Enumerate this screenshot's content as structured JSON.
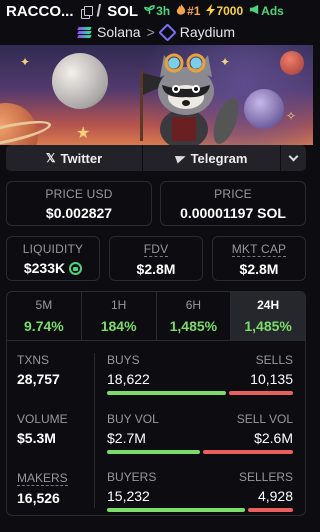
{
  "header": {
    "token_name": "RACCO...",
    "slash": "/",
    "quote": "SOL",
    "age": "3h",
    "rank": "#1",
    "boosts": "7000",
    "ads": "Ads"
  },
  "chain": {
    "chain_name": "Solana",
    "separator": ">",
    "dex_name": "Raydium"
  },
  "social": {
    "twitter_label": "Twitter",
    "telegram_label": "Telegram"
  },
  "price_usd": {
    "label": "PRICE USD",
    "value": "$0.002827"
  },
  "price_native": {
    "label": "PRICE",
    "value": "0.00001197 SOL"
  },
  "liquidity": {
    "label": "LIQUIDITY",
    "value": "$233K"
  },
  "fdv": {
    "label": "FDV",
    "value": "$2.8M"
  },
  "mcap": {
    "label": "MKT CAP",
    "value": "$2.8M"
  },
  "tabs": [
    {
      "label": "5M",
      "change": "9.74%"
    },
    {
      "label": "1H",
      "change": "184%"
    },
    {
      "label": "6H",
      "change": "1,485%"
    },
    {
      "label": "24H",
      "change": "1,485%"
    }
  ],
  "active_tab": "24H",
  "txns": {
    "label": "TXNS",
    "value": "28,757",
    "buys_label": "BUYS",
    "buys": "18,622",
    "sells_label": "SELLS",
    "sells": "10,135",
    "buy_fraction": 0.648
  },
  "volume": {
    "label": "VOLUME",
    "value": "$5.3M",
    "buy_label": "BUY VOL",
    "buy": "$2.7M",
    "sell_label": "SELL VOL",
    "sell": "$2.6M",
    "buy_fraction": 0.51
  },
  "makers": {
    "label": "MAKERS",
    "value": "16,526",
    "buyers_label": "BUYERS",
    "buyers": "15,232",
    "sellers_label": "SELLERS",
    "sellers": "4,928",
    "buy_fraction": 0.756
  },
  "colors": {
    "positive": "#7bdc6a",
    "negative": "#ea5e5e",
    "rank": "#f7a54a",
    "boost": "#f7d23b"
  },
  "icons": [
    "copy-icon",
    "seedling-icon",
    "fire-icon",
    "bolt-icon",
    "megaphone-icon",
    "solana-icon",
    "raydium-icon",
    "x-icon",
    "telegram-icon",
    "chevron-down-icon",
    "lock-icon"
  ]
}
